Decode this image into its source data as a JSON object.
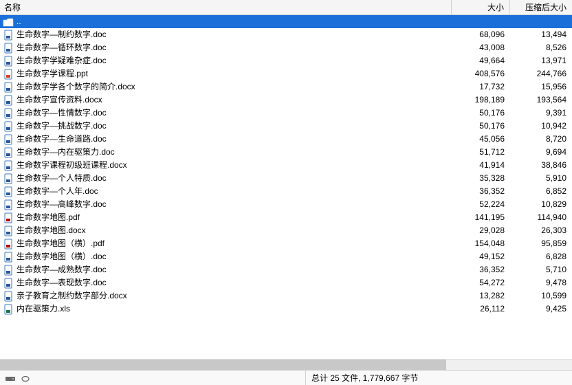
{
  "columns": {
    "name": "名称",
    "size": "大小",
    "packed": "压缩后大小"
  },
  "parent_row": {
    "label": ".."
  },
  "status": {
    "summary": "总计 25 文件, 1,779,667 字节"
  },
  "rows": [
    {
      "icon": "doc",
      "name": "生命数字—制约数字.doc",
      "size": "68,096",
      "packed": "13,494"
    },
    {
      "icon": "doc",
      "name": "生命数字—循环数字.doc",
      "size": "43,008",
      "packed": "8,526"
    },
    {
      "icon": "doc",
      "name": "生命数字学疑难杂症.doc",
      "size": "49,664",
      "packed": "13,971"
    },
    {
      "icon": "ppt",
      "name": "生命数字学课程.ppt",
      "size": "408,576",
      "packed": "244,766"
    },
    {
      "icon": "docx",
      "name": "生命数字学各个数字的简介.docx",
      "size": "17,732",
      "packed": "15,956"
    },
    {
      "icon": "docx",
      "name": "生命数字宣传资料.docx",
      "size": "198,189",
      "packed": "193,564"
    },
    {
      "icon": "doc",
      "name": "生命数字—性情数字.doc",
      "size": "50,176",
      "packed": "9,391"
    },
    {
      "icon": "doc",
      "name": "生命数字—挑战数字.doc",
      "size": "50,176",
      "packed": "10,942"
    },
    {
      "icon": "doc",
      "name": "生命数字—生命道路.doc",
      "size": "45,056",
      "packed": "8,720"
    },
    {
      "icon": "doc",
      "name": "生命数字—内在驱策力.doc",
      "size": "51,712",
      "packed": "9,694"
    },
    {
      "icon": "docx",
      "name": "生命数字课程初级班课程.docx",
      "size": "41,914",
      "packed": "38,846"
    },
    {
      "icon": "doc",
      "name": "生命数字—个人特质.doc",
      "size": "35,328",
      "packed": "5,910"
    },
    {
      "icon": "doc",
      "name": "生命数字—个人年.doc",
      "size": "36,352",
      "packed": "6,852"
    },
    {
      "icon": "doc",
      "name": "生命数字—高峰数字.doc",
      "size": "52,224",
      "packed": "10,829"
    },
    {
      "icon": "pdf",
      "name": "生命数字地图.pdf",
      "size": "141,195",
      "packed": "114,940"
    },
    {
      "icon": "docx",
      "name": "生命数字地图.docx",
      "size": "29,028",
      "packed": "26,303"
    },
    {
      "icon": "pdf",
      "name": "生命数字地图（横）.pdf",
      "size": "154,048",
      "packed": "95,859"
    },
    {
      "icon": "doc",
      "name": "生命数字地图（横）.doc",
      "size": "49,152",
      "packed": "6,828"
    },
    {
      "icon": "doc",
      "name": "生命数字—成熟数字.doc",
      "size": "36,352",
      "packed": "5,710"
    },
    {
      "icon": "doc",
      "name": "生命数字—表现数字.doc",
      "size": "54,272",
      "packed": "9,478"
    },
    {
      "icon": "docx",
      "name": "亲子教育之制约数字部分.docx",
      "size": "13,282",
      "packed": "10,599"
    },
    {
      "icon": "xls",
      "name": "内在驱策力.xls",
      "size": "26,112",
      "packed": "9,425"
    }
  ]
}
